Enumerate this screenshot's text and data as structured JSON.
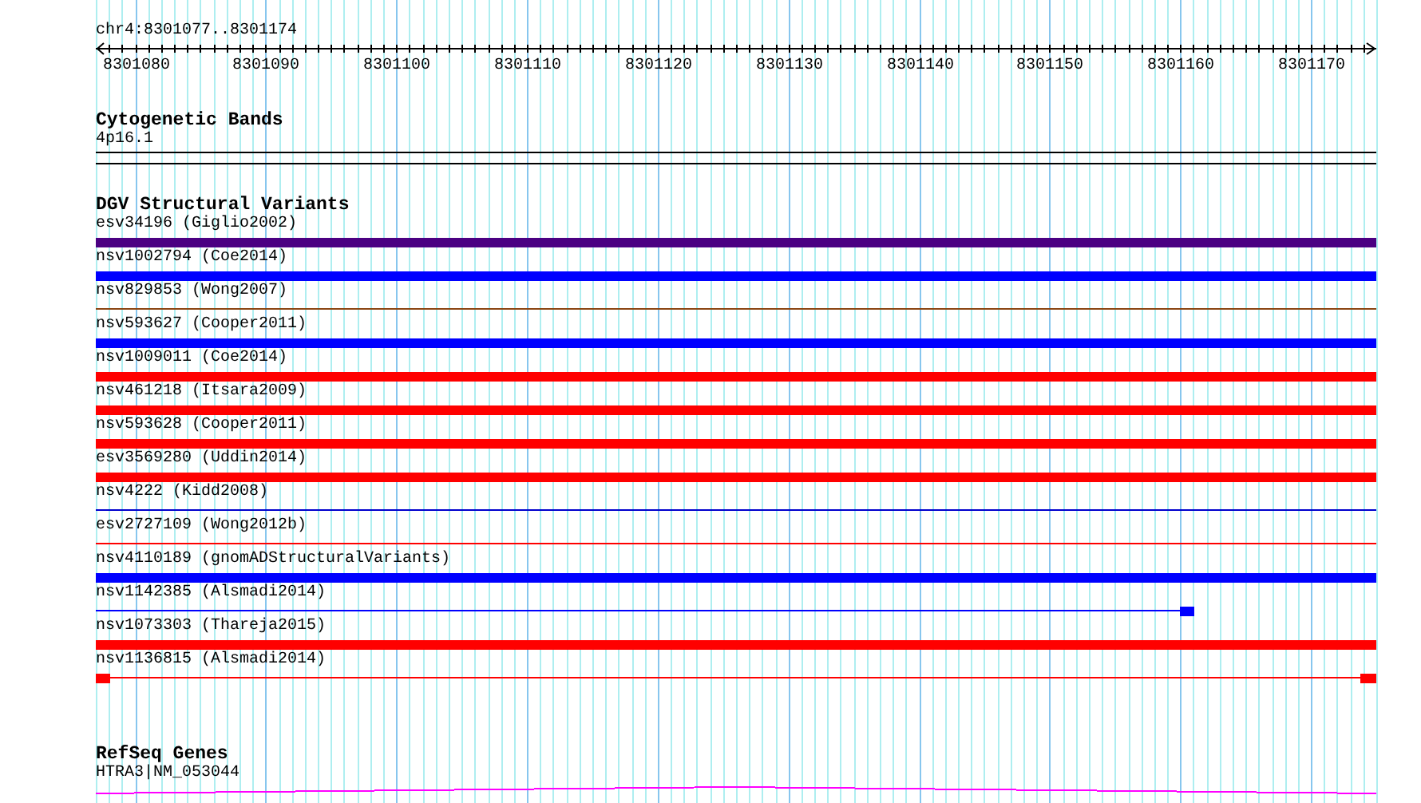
{
  "ruler": {
    "location": "chr4:8301077..8301174",
    "tick_labels": [
      "8301080",
      "8301090",
      "8301100",
      "8301110",
      "8301120",
      "8301130",
      "8301140",
      "8301150",
      "8301160",
      "8301170"
    ]
  },
  "tracks": [
    {
      "title": "Cytogenetic Bands",
      "kind": "bands",
      "features": [
        {
          "label": "4p16.1",
          "kind": "band"
        }
      ]
    },
    {
      "title": "DGV Structural Variants",
      "kind": "variants",
      "features": [
        {
          "label": "esv34196 (Giglio2002)",
          "color": "#4b0082",
          "kind": "thick"
        },
        {
          "label": "nsv1002794 (Coe2014)",
          "color": "#0000ff",
          "kind": "thick"
        },
        {
          "label": "nsv829853 (Wong2007)",
          "color": "#8b4513",
          "kind": "thin"
        },
        {
          "label": "nsv593627 (Cooper2011)",
          "color": "#0000ff",
          "kind": "thick"
        },
        {
          "label": "nsv1009011 (Coe2014)",
          "color": "#ff0000",
          "kind": "thick"
        },
        {
          "label": "nsv461218 (Itsara2009)",
          "color": "#ff0000",
          "kind": "thick"
        },
        {
          "label": "nsv593628 (Cooper2011)",
          "color": "#ff0000",
          "kind": "thick"
        },
        {
          "label": "esv3569280 (Uddin2014)",
          "color": "#ff0000",
          "kind": "thick"
        },
        {
          "label": "nsv4222 (Kidd2008)",
          "color": "#0000cd",
          "kind": "thin"
        },
        {
          "label": "esv2727109 (Wong2012b)",
          "color": "#ff0000",
          "kind": "thin"
        },
        {
          "label": "nsv4110189 (gnomADStructuralVariants)",
          "color": "#0000ff",
          "kind": "thick"
        },
        {
          "label": "nsv1142385 (Alsmadi2014)",
          "color": "#0000ff",
          "kind": "ends-in-view"
        },
        {
          "label": "nsv1073303 (Thareja2015)",
          "color": "#ff0000",
          "kind": "thick"
        },
        {
          "label": "nsv1136815 (Alsmadi2014)",
          "color": "#ff0000",
          "kind": "blocks-at-edges"
        }
      ]
    },
    {
      "title": "RefSeq Genes",
      "kind": "genes",
      "features": [
        {
          "label": "HTRA3|NM_053044",
          "color": "#ff00ff",
          "kind": "intron"
        }
      ]
    }
  ]
}
